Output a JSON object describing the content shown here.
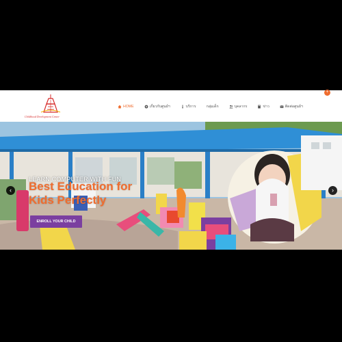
{
  "header": {
    "logo_caption": "Childhood Development Center",
    "badge": "+"
  },
  "nav": {
    "items": [
      {
        "label": "HOME",
        "icon": "home-icon"
      },
      {
        "label": "เกี่ยวกับศูนย์ฯ",
        "icon": "gear-icon"
      },
      {
        "label": "บริการ",
        "icon": "info-icon"
      },
      {
        "label": "กลุ่มเด็ก",
        "icon": ""
      },
      {
        "label": "บุคลากร",
        "icon": "users-icon"
      },
      {
        "label": "ข่าว",
        "icon": "book-icon"
      },
      {
        "label": "ติดต่อศูนย์ฯ",
        "icon": "mail-icon"
      }
    ]
  },
  "hero": {
    "kicker": "LEARN COMPUTER WITH FUN",
    "title_line1": "Best Education for",
    "title_line2": "Kids Perfectly",
    "button": "ENROLL YOUR CHILD",
    "prev": "‹",
    "next": "›"
  },
  "colors": {
    "accent": "#ef6d2f",
    "button": "#7b3fa0",
    "roof": "#2f8fd6"
  }
}
